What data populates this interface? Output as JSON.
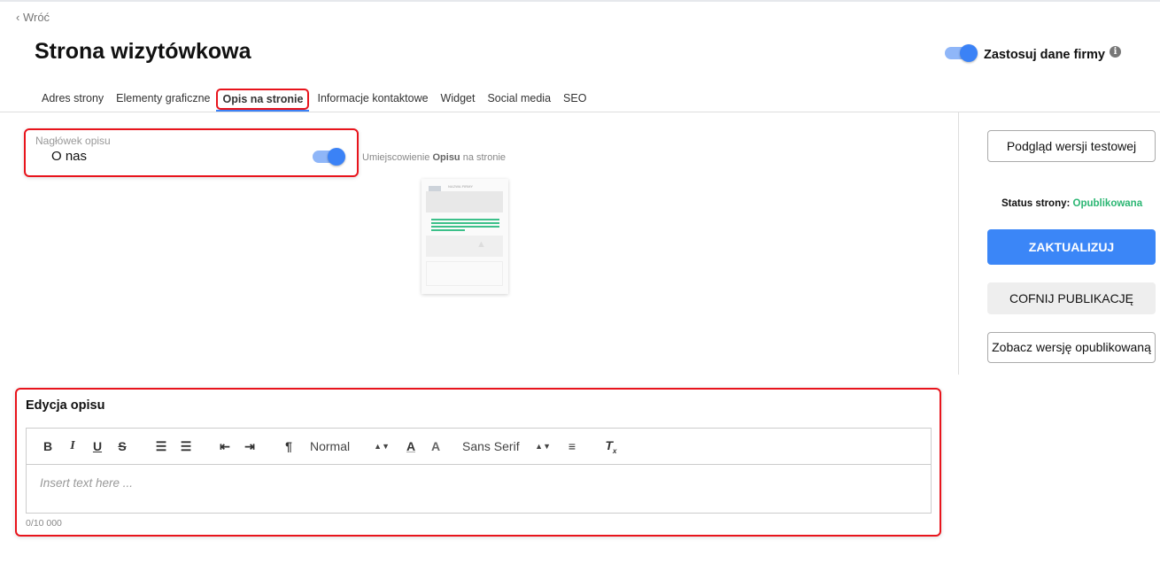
{
  "nav": {
    "back": "Wróć"
  },
  "header": {
    "title": "Strona wizytówkowa",
    "company_toggle_label": "Zastosuj dane firmy",
    "company_toggle_on": true,
    "info_icon": "info-icon"
  },
  "tabs": [
    {
      "label": "Adres strony"
    },
    {
      "label": "Elementy graficzne"
    },
    {
      "label": "Opis na stronie",
      "active": true
    },
    {
      "label": "Informacje kontaktowe"
    },
    {
      "label": "Widget"
    },
    {
      "label": "Social media"
    },
    {
      "label": "SEO"
    }
  ],
  "description_header": {
    "label": "Nagłówek opisu",
    "value": "O nas",
    "toggle_on": true,
    "placement_prefix": "Umiejscowienie ",
    "placement_bold": "Opisu",
    "placement_suffix": " na stronie",
    "thumbnail_title": "NAZWA FIRMY"
  },
  "sidebar": {
    "preview_button": "Podgląd wersji testowej",
    "status_label": "Status strony: ",
    "status_value": "Opublikowana",
    "update_button": "ZAKTUALIZUJ",
    "unpublish_button": "COFNIJ PUBLIKACJĘ",
    "view_published_button": "Zobacz wersję opublikowaną"
  },
  "editor": {
    "title": "Edycja opisu",
    "format_select": "Normal",
    "font_select": "Sans Serif",
    "placeholder": "Insert text here ...",
    "counter": "0/10 000"
  },
  "colors": {
    "accent": "#3b86f7",
    "status": "#2bb673",
    "highlight": "#e8141c"
  }
}
